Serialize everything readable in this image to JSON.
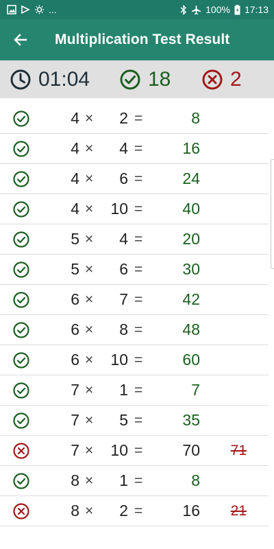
{
  "status_bar": {
    "battery": "100%",
    "time": "17:13",
    "more": "..."
  },
  "app_bar": {
    "title": "Multiplication Test Result"
  },
  "summary": {
    "time": "01:04",
    "correct": "18",
    "wrong": "2"
  },
  "colors": {
    "primary": "#26856f",
    "status_bar": "#1f7a68",
    "correct": "#1b5e20",
    "wrong": "#a01818"
  },
  "symbols": {
    "times": "×",
    "equals": "="
  },
  "rows": [
    {
      "a": "4",
      "b": "2",
      "answer": "8",
      "correct": true,
      "user": ""
    },
    {
      "a": "4",
      "b": "4",
      "answer": "16",
      "correct": true,
      "user": ""
    },
    {
      "a": "4",
      "b": "6",
      "answer": "24",
      "correct": true,
      "user": ""
    },
    {
      "a": "4",
      "b": "10",
      "answer": "40",
      "correct": true,
      "user": ""
    },
    {
      "a": "5",
      "b": "4",
      "answer": "20",
      "correct": true,
      "user": ""
    },
    {
      "a": "5",
      "b": "6",
      "answer": "30",
      "correct": true,
      "user": ""
    },
    {
      "a": "6",
      "b": "7",
      "answer": "42",
      "correct": true,
      "user": ""
    },
    {
      "a": "6",
      "b": "8",
      "answer": "48",
      "correct": true,
      "user": ""
    },
    {
      "a": "6",
      "b": "10",
      "answer": "60",
      "correct": true,
      "user": ""
    },
    {
      "a": "7",
      "b": "1",
      "answer": "7",
      "correct": true,
      "user": ""
    },
    {
      "a": "7",
      "b": "5",
      "answer": "35",
      "correct": true,
      "user": ""
    },
    {
      "a": "7",
      "b": "10",
      "answer": "70",
      "correct": false,
      "user": "71"
    },
    {
      "a": "8",
      "b": "1",
      "answer": "8",
      "correct": true,
      "user": ""
    },
    {
      "a": "8",
      "b": "2",
      "answer": "16",
      "correct": false,
      "user": "21"
    }
  ]
}
